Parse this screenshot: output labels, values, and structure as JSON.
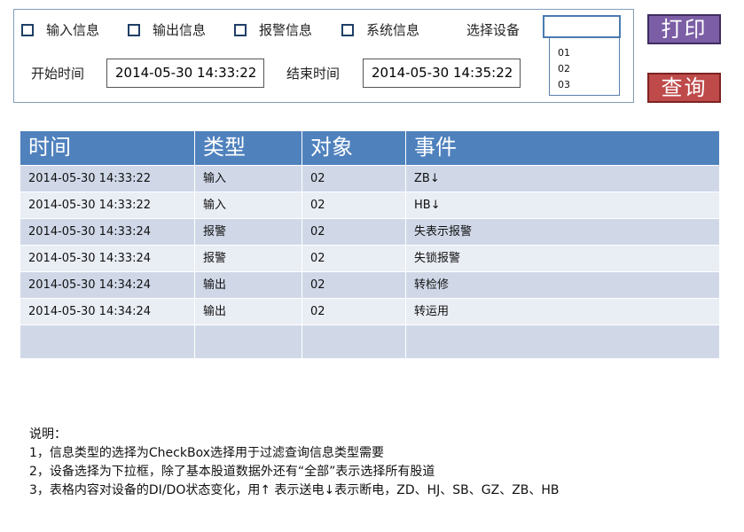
{
  "filters": {
    "types": [
      {
        "label": "输入信息",
        "checked": false
      },
      {
        "label": "输出信息",
        "checked": false
      },
      {
        "label": "报警信息",
        "checked": false
      },
      {
        "label": "系统信息",
        "checked": false
      }
    ],
    "device_label": "选择设备",
    "device_value": "",
    "device_options": [
      "01",
      "02",
      "03"
    ],
    "start_label": "开始时间",
    "start_value": "2014-05-30 14:33:22",
    "end_label": "结束时间",
    "end_value": "2014-05-30 14:35:22"
  },
  "buttons": {
    "print": "打印",
    "query": "查询"
  },
  "table": {
    "headers": [
      "时间",
      "类型",
      "对象",
      "事件"
    ],
    "rows": [
      [
        "2014-05-30 14:33:22",
        "输入",
        "02",
        "ZB↓"
      ],
      [
        "2014-05-30 14:33:22",
        "输入",
        "02",
        "HB↓"
      ],
      [
        "2014-05-30 14:33:24",
        "报警",
        "02",
        "失表示报警"
      ],
      [
        "2014-05-30 14:33:24",
        "报警",
        "02",
        "失锁报警"
      ],
      [
        "2014-05-30 14:34:24",
        "输出",
        "02",
        "转检修"
      ],
      [
        "2014-05-30 14:34:24",
        "输出",
        "02",
        "转运用"
      ],
      [
        "",
        "",
        "",
        ""
      ]
    ]
  },
  "notes": {
    "title": "说明：",
    "lines": [
      "1，信息类型的选择为CheckBox选择用于过滤查询信息类型需要",
      "2，设备选择为下拉框，除了基本股道数据外还有“全部”表示选择所有股道",
      "3，表格内容对设备的DI/DO状态变化，用↑ 表示送电↓表示断电，ZD、HJ、SB、GZ、ZB、HB"
    ]
  },
  "colors": {
    "header_bg": "#4f81bd",
    "row_odd": "#d0d8e8",
    "row_even": "#e9edf4",
    "print_btn": "#7b5ea5",
    "query_btn": "#bf4a4a",
    "panel_border": "#7f9db9"
  }
}
